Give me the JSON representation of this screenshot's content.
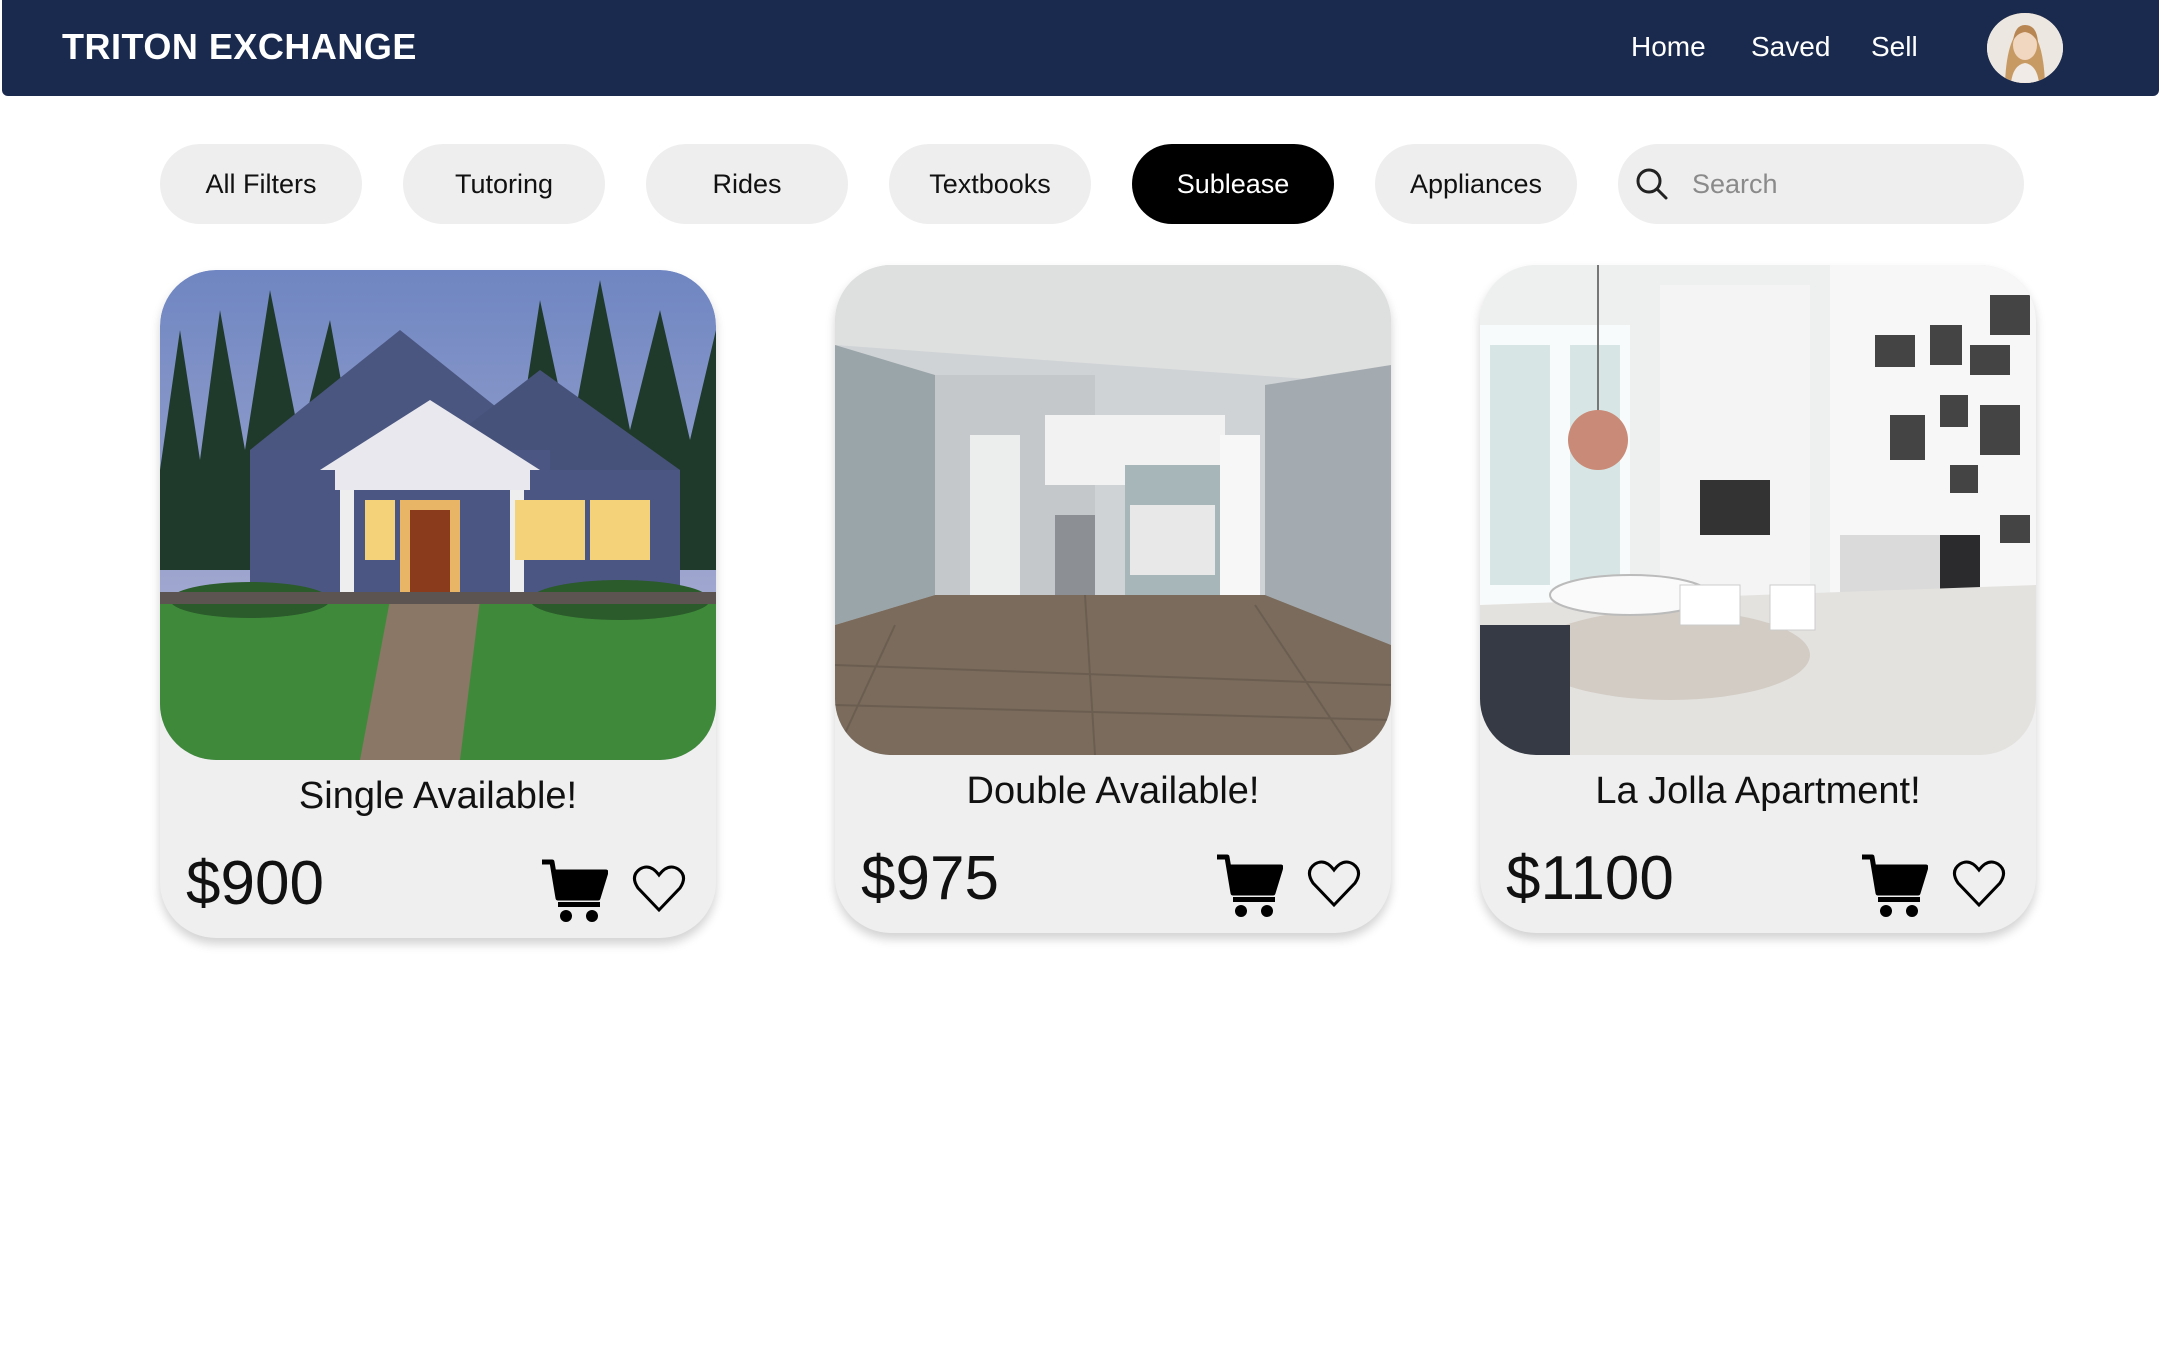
{
  "header": {
    "brand": "TRITON EXCHANGE",
    "nav": [
      {
        "label": "Home"
      },
      {
        "label": "Saved"
      },
      {
        "label": "Sell"
      }
    ],
    "avatar_icon": "user-avatar"
  },
  "filters": {
    "items": [
      {
        "label": "All Filters",
        "active": false
      },
      {
        "label": "Tutoring",
        "active": false
      },
      {
        "label": "Rides",
        "active": false
      },
      {
        "label": "Textbooks",
        "active": false
      },
      {
        "label": "Sublease",
        "active": true
      },
      {
        "label": "Appliances",
        "active": false
      }
    ],
    "search": {
      "placeholder": "Search",
      "value": "",
      "icon": "search-icon"
    }
  },
  "listings": [
    {
      "title": "Single Available!",
      "price": "$900",
      "image": "house-exterior",
      "actions": [
        "cart-icon",
        "heart-icon"
      ]
    },
    {
      "title": "Double Available!",
      "price": "$975",
      "image": "apartment-interior-empty",
      "actions": [
        "cart-icon",
        "heart-icon"
      ]
    },
    {
      "title": "La Jolla Apartment!",
      "price": "$1100",
      "image": "apartment-living-room",
      "actions": [
        "cart-icon",
        "heart-icon"
      ]
    }
  ],
  "colors": {
    "navbar": "#1a2a4f",
    "pill": "#eeeeee",
    "active_pill": "#000000",
    "card": "#efefef"
  }
}
